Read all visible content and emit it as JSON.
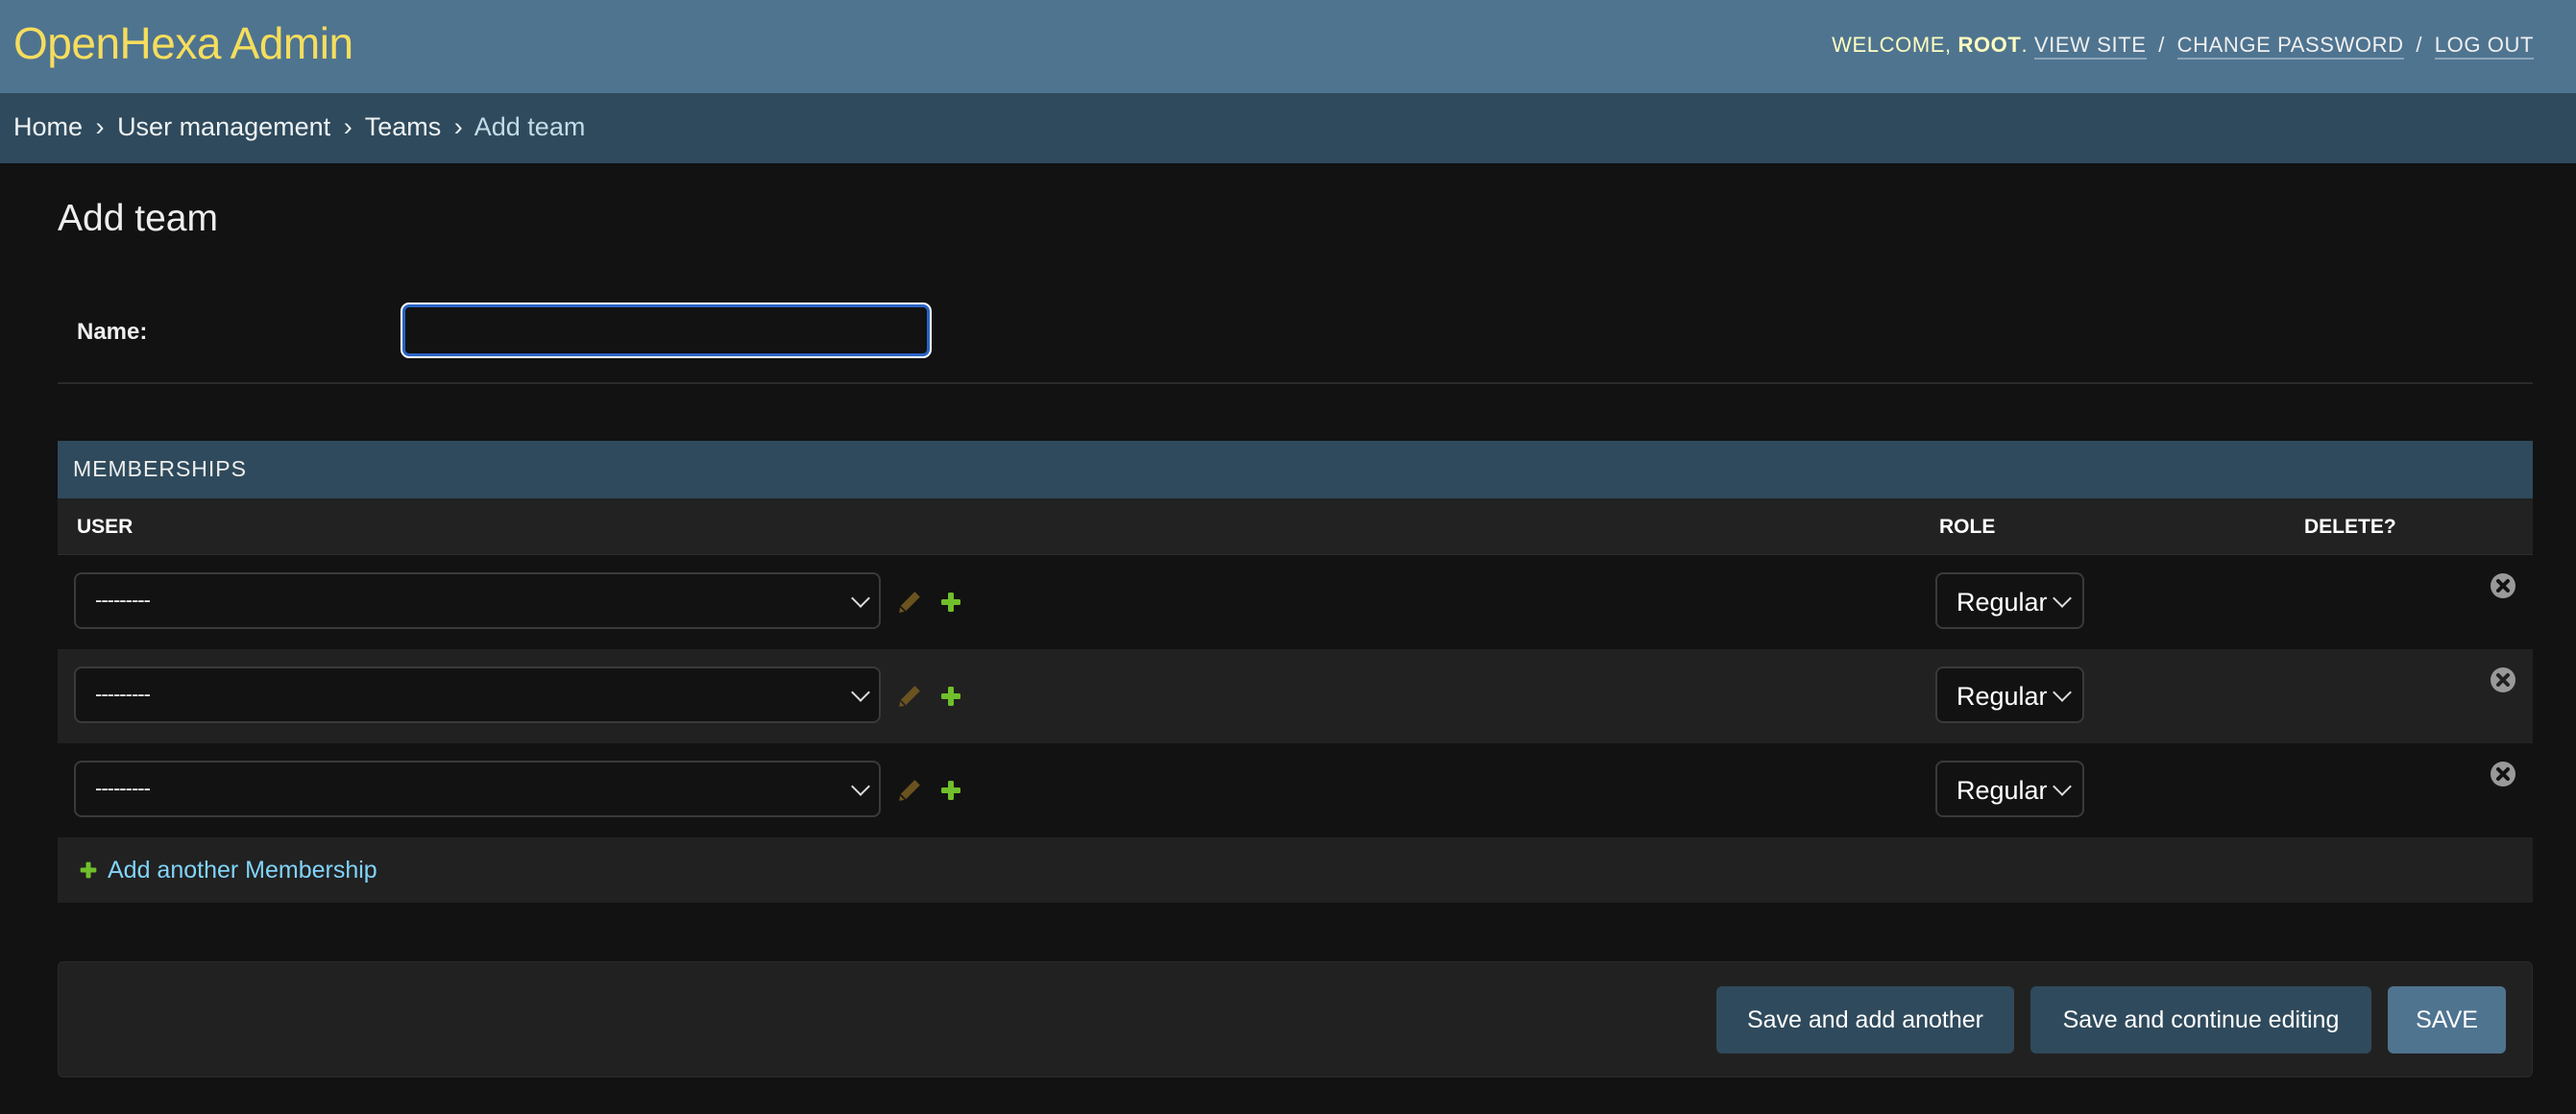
{
  "header": {
    "brand": "OpenHexa Admin",
    "welcome": "Welcome,",
    "username": "root",
    "period": ".",
    "links": [
      "View site",
      "Change password",
      "Log out"
    ],
    "separator": "/"
  },
  "breadcrumbs": {
    "items": [
      "Home",
      "User management",
      "Teams"
    ],
    "current": "Add team",
    "separator": "›"
  },
  "page": {
    "title": "Add team"
  },
  "form": {
    "name_label": "Name:",
    "name_value": ""
  },
  "memberships": {
    "caption": "MEMBERSHIPS",
    "columns": {
      "user": "User",
      "role": "Role",
      "delete": "Delete?"
    },
    "rows": [
      {
        "user": "---------",
        "role": "Regular"
      },
      {
        "user": "---------",
        "role": "Regular"
      },
      {
        "user": "---------",
        "role": "Regular"
      }
    ],
    "add_another": "Add another Membership"
  },
  "icons": {
    "change": "pencil-icon",
    "add": "plus-icon",
    "delete": "delete-x-icon"
  },
  "colors": {
    "header_bg": "#4f7490",
    "breadcrumb_bg": "#2f4a5c",
    "brand": "#f5dd5d",
    "link": "#81d4fa",
    "add_green": "#70bf2b",
    "change_brown": "#6b5320",
    "focus_blue": "#2a64c5"
  },
  "submit": {
    "save_add_another": "Save and add another",
    "save_continue": "Save and continue editing",
    "save": "Save"
  }
}
